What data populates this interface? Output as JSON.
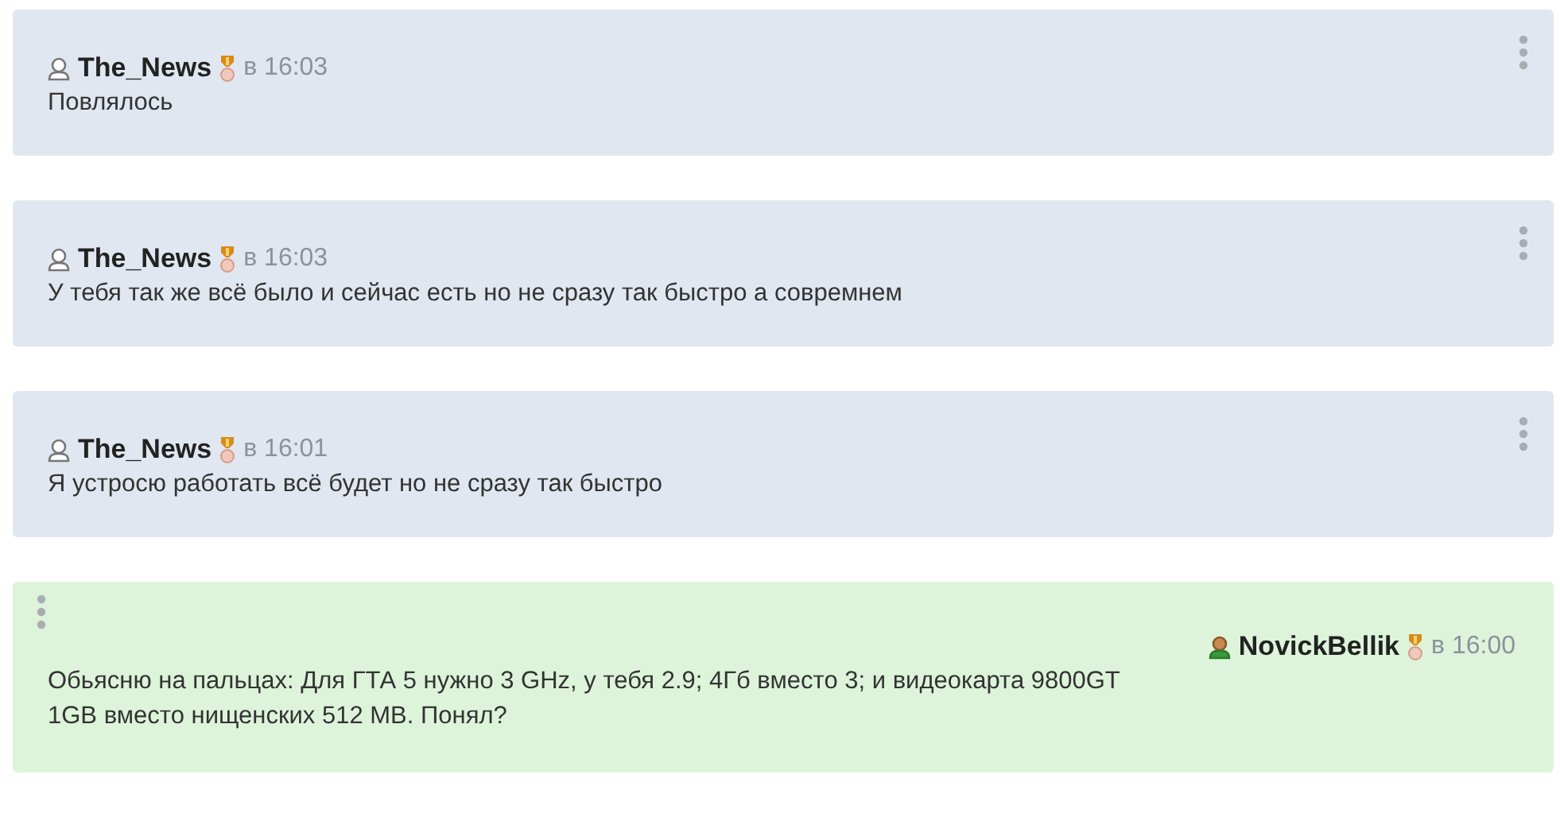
{
  "messages": [
    {
      "kind": "other",
      "author": "The_News",
      "time": "в 16:03",
      "text": "Повлялось"
    },
    {
      "kind": "other",
      "author": "The_News",
      "time": "в 16:03",
      "text": "У тебя так же всё было и сейчас есть но не сразу так быстро а совремнем"
    },
    {
      "kind": "other",
      "author": "The_News",
      "time": "в 16:01",
      "text": "Я устросю работать всё будет но не сразу так быстро"
    },
    {
      "kind": "own",
      "author": "NovickBellik",
      "time": "в 16:00",
      "text": "Обьясню на пальцах: Для ГТА 5 нужно 3 GHz, у тебя 2.9; 4Гб вместо 3; и видеокарта 9800GT 1GB вместо нищенских 512 MB. Понял?"
    }
  ]
}
